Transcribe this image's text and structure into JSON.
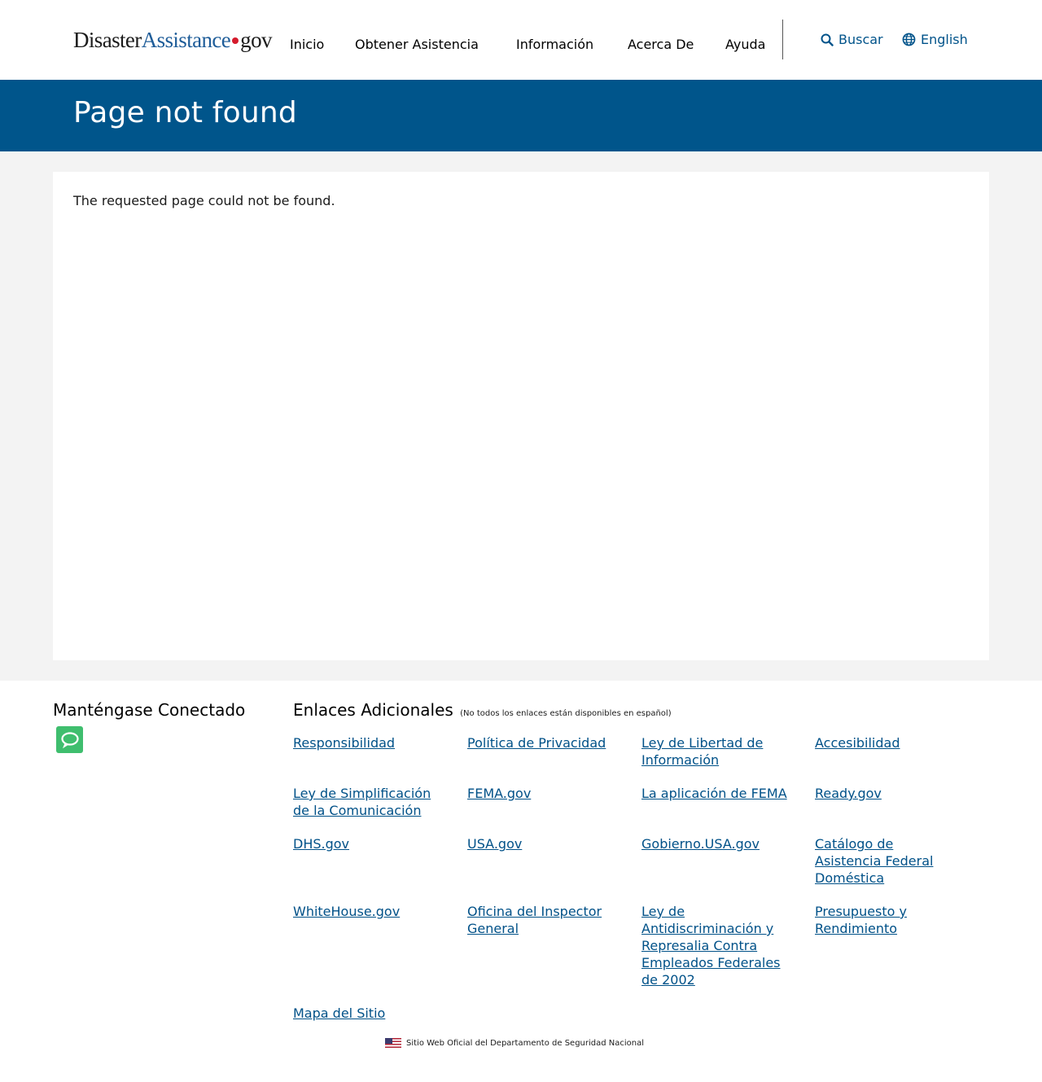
{
  "header": {
    "logo": {
      "part1": "Disaster",
      "part2": "Assistance",
      "part3": "gov"
    },
    "nav": [
      {
        "label": "Inicio"
      },
      {
        "label": "Obtener Asistencia"
      },
      {
        "label": "Información"
      },
      {
        "label": "Acerca De"
      },
      {
        "label": "Ayuda"
      }
    ],
    "search_label": "Buscar",
    "language_label": "English"
  },
  "banner": {
    "title": "Page not found"
  },
  "main": {
    "message": "The requested page could not be found."
  },
  "footer": {
    "connect_title": "Manténgase Conectado",
    "links_title": "Enlaces Adicionales",
    "links_note": "(No todos los enlaces están disponibles en español)",
    "links": [
      "Responsibilidad",
      "Política de Privacidad",
      "Ley de Libertad de Información",
      "Accesibilidad",
      "Ley de Simplificación de la Comunicación",
      "FEMA.gov",
      "La aplicación de FEMA",
      "Ready.gov",
      "DHS.gov",
      "USA.gov",
      "Gobierno.USA.gov",
      "Catálogo de Asistencia Federal Doméstica",
      "WhiteHouse.gov",
      "Oficina del Inspector General",
      "Ley de Antidiscriminación y Represalia Contra Empleados Federales de 2002",
      "Presupuesto y Rendimiento",
      "Mapa del Sitio"
    ],
    "official_text": "Sitio Web Oficial del Departamento de Seguridad Nacional"
  },
  "colors": {
    "banner_bg": "#00558b",
    "link": "#005188",
    "logo_accent": "#1f5d99",
    "logo_dot": "#d51b2c",
    "chat_green": "#3fbe6e",
    "page_bg": "#f3f3f3"
  },
  "icons": {
    "search": "magnifier-icon",
    "language": "globe-icon",
    "chat": "chat-bubble-icon",
    "flag": "us-flag-icon"
  }
}
